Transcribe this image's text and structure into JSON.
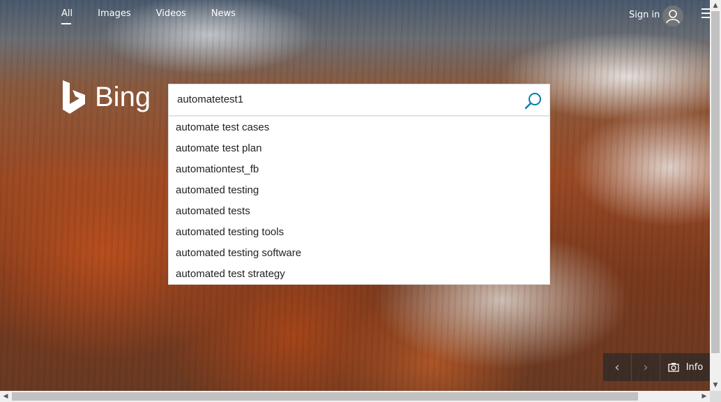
{
  "nav": {
    "tabs": [
      {
        "label": "All",
        "active": true
      },
      {
        "label": "Images"
      },
      {
        "label": "Videos"
      },
      {
        "label": "News"
      }
    ]
  },
  "header": {
    "signin_label": "Sign in",
    "avatar_icon": "user-icon",
    "menu_icon": "hamburger-menu-icon"
  },
  "logo": {
    "text": "Bing",
    "icon": "bing-logo-icon"
  },
  "search": {
    "value": "automatetest1",
    "button_icon": "search-icon",
    "accent_color": "#007daa"
  },
  "suggestions": [
    "automate test cases",
    "automate test plan",
    "automationtest_fb",
    "automated testing",
    "automated tests",
    "automated testing tools",
    "automated testing software",
    "automated test strategy"
  ],
  "controls": {
    "prev_icon": "chevron-left-icon",
    "next_icon": "chevron-right-icon",
    "camera_icon": "camera-icon",
    "info_label": "Info"
  }
}
